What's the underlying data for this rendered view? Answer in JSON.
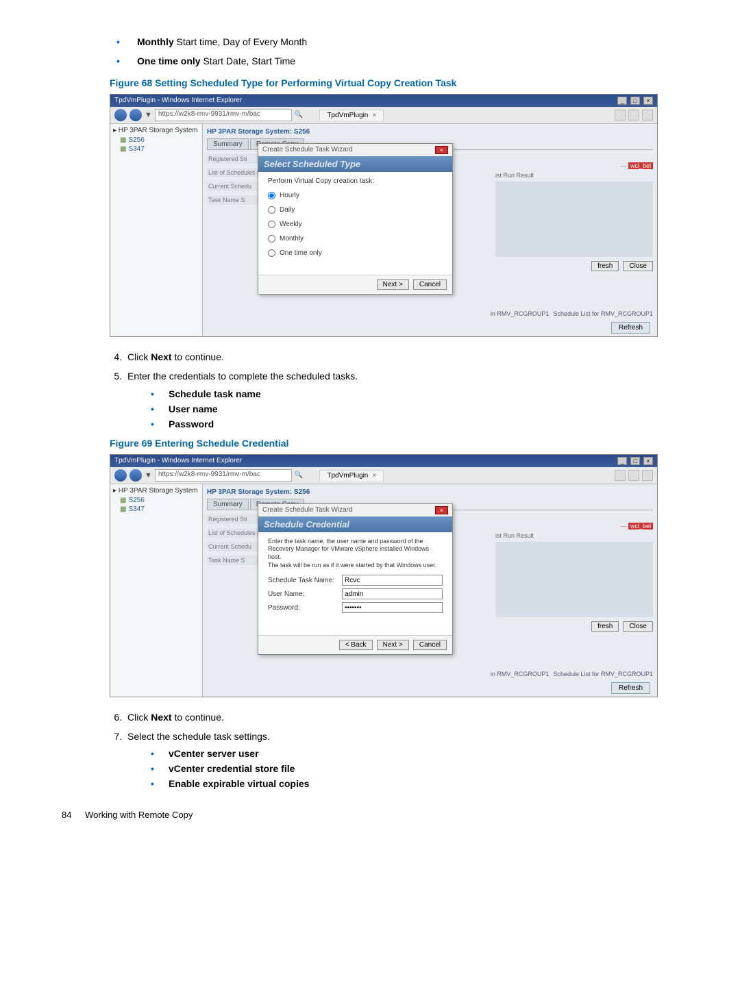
{
  "intro_bullets": [
    {
      "bold": "Monthly",
      "rest": "  Start time, Day of Every Month"
    },
    {
      "bold": "One time only",
      "rest": "  Start Date, Start Time"
    }
  ],
  "fig68": {
    "title": "Figure 68 Setting Scheduled Type for Performing Virtual Copy Creation Task",
    "ie_title": "TpdVmPlugin - Windows Internet Explorer",
    "url": "https://w2k8-rmv-9931/rmv-m/bac",
    "tab_label": "TpdVmPlugin",
    "sidebar_root": "▸ HP 3PAR Storage System",
    "sidebar_item1": "S256",
    "sidebar_item2": "S347",
    "header": "HP 3PAR Storage System:  S256",
    "tab1": "Summary",
    "tab2": "Remote Copy",
    "faded1": "Registered Sti",
    "faded2": "List of Schedules i",
    "faded3": "Current Schedu",
    "faded4": "Task Name    S",
    "rcol_run": "ist Run Result",
    "rcol_top": "—",
    "rcol_red": "wcl_bel",
    "btn_fresh": "fresh",
    "btn_close": "Close",
    "bottom1": "in RMV_RCGROUP1",
    "bottom2": "Schedule List for RMV_RCGROUP1",
    "refresh": "Refresh",
    "wizard": {
      "title": "Create Schedule Task Wizard",
      "band": "Select Scheduled Type",
      "subhead": "Perform Virtual Copy creation task:",
      "opt1": "Hourly",
      "opt2": "Daily",
      "opt3": "Weekly",
      "opt4": "Monthly",
      "opt5": "One time only",
      "next": "Next >",
      "cancel": "Cancel"
    }
  },
  "step4": {
    "num": "4.",
    "text_pre": "Click ",
    "text_bold": "Next",
    "text_post": " to continue."
  },
  "step5": {
    "num": "5.",
    "text": "Enter the credentials to complete the scheduled tasks."
  },
  "step5_bullets": [
    "Schedule task name",
    "User name",
    "Password"
  ],
  "fig69": {
    "title": "Figure 69 Entering Schedule Credential",
    "ie_title": "TpdVmPlugin - Windows Internet Explorer",
    "url": "https://w2k8-rmv-9931/rmv-m/bac",
    "tab_label": "TpdVmPlugin",
    "header": "HP 3PAR Storage System:  S256",
    "wizard": {
      "title": "Create Schedule Task Wizard",
      "band": "Schedule Credential",
      "desc1": "Enter the task name, the user name and password of the",
      "desc2": "Recovery Manager for VMware vSphere installed Windows host.",
      "desc3": "The task will be run as if it were started by that Windows user.",
      "f1_label": "Schedule Task Name:",
      "f1_val": "Rcvc",
      "f2_label": "User Name:",
      "f2_val": "admin",
      "f3_label": "Password:",
      "f3_val": "•••••••",
      "back": "< Back",
      "next": "Next >",
      "cancel": "Cancel"
    }
  },
  "step6": {
    "num": "6.",
    "text_pre": "Click ",
    "text_bold": "Next",
    "text_post": " to continue."
  },
  "step7": {
    "num": "7.",
    "text": "Select the schedule task settings."
  },
  "step7_bullets": [
    "vCenter server user",
    "vCenter credential store file",
    "Enable expirable virtual copies"
  ],
  "footer": {
    "page": "84",
    "section": "Working with Remote Copy"
  }
}
